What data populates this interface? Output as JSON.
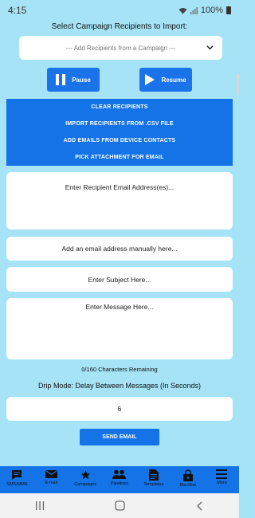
{
  "status_bar": {
    "time": "4:15",
    "battery": "100%"
  },
  "import": {
    "heading": "Select Campaign Recipients to Import:",
    "select_value": "--- Add Recipients from a Campaign ---"
  },
  "controls": {
    "pause_label": "Pause",
    "resume_label": "Resume"
  },
  "actions": [
    "CLEAR RECIPIENTS",
    "IMPORT RECIPIENTS FROM .CSV FILE",
    "ADD EMAILS FROM DEVICE CONTACTS",
    "PICK ATTACHMENT FOR EMAIL"
  ],
  "fields": {
    "recipients_placeholder": "Enter Recipient Email Address(es)...",
    "manual_email_placeholder": "Add an email address manually here...",
    "subject_placeholder": "Enter Subject Here...",
    "message_placeholder": "Enter Message Here..."
  },
  "char_counter": "0/160 Characters Remaining",
  "drip": {
    "label": "Drip Mode: Delay Between Messages (In Seconds)",
    "value": "6"
  },
  "send_label": "SEND EMAIL",
  "bottom_nav": [
    {
      "label": "SMS/MMS",
      "icon": "sms-icon"
    },
    {
      "label": "E-mail",
      "icon": "email-icon"
    },
    {
      "label": "Campaigns",
      "icon": "star-icon"
    },
    {
      "label": "Pipelines",
      "icon": "people-icon"
    },
    {
      "label": "Templates",
      "icon": "document-icon"
    },
    {
      "label": "Blacklist",
      "icon": "lock-icon"
    },
    {
      "label": "More",
      "icon": "menu-icon"
    }
  ],
  "colors": {
    "background": "#a6e3f6",
    "primary": "#1473e6"
  }
}
